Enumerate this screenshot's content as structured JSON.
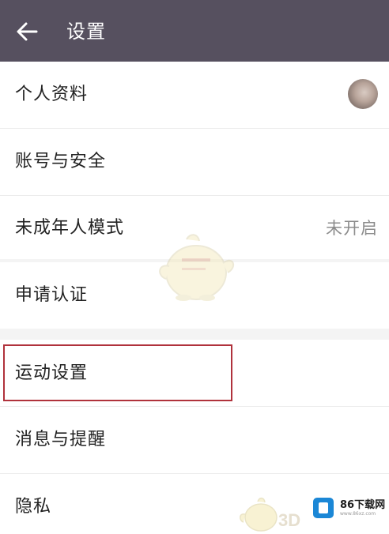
{
  "app_bar": {
    "title": "设置"
  },
  "settings": {
    "profile": {
      "label": "个人资料"
    },
    "account_security": {
      "label": "账号与安全"
    },
    "minor_mode": {
      "label": "未成年人模式",
      "value": "未开启"
    },
    "verification": {
      "label": "申请认证"
    },
    "sport_settings": {
      "label": "运动设置"
    },
    "notifications": {
      "label": "消息与提醒"
    },
    "privacy": {
      "label": "隐私"
    }
  },
  "watermark": {
    "site_name": "86下载网",
    "site_url": "www.86xz.com",
    "brand_text": "3D"
  },
  "colors": {
    "app_bar_bg": "#56505f",
    "highlight_border": "#b0323c",
    "divider": "#f4f4f4"
  },
  "icons": {
    "back": "arrow-left-icon"
  }
}
